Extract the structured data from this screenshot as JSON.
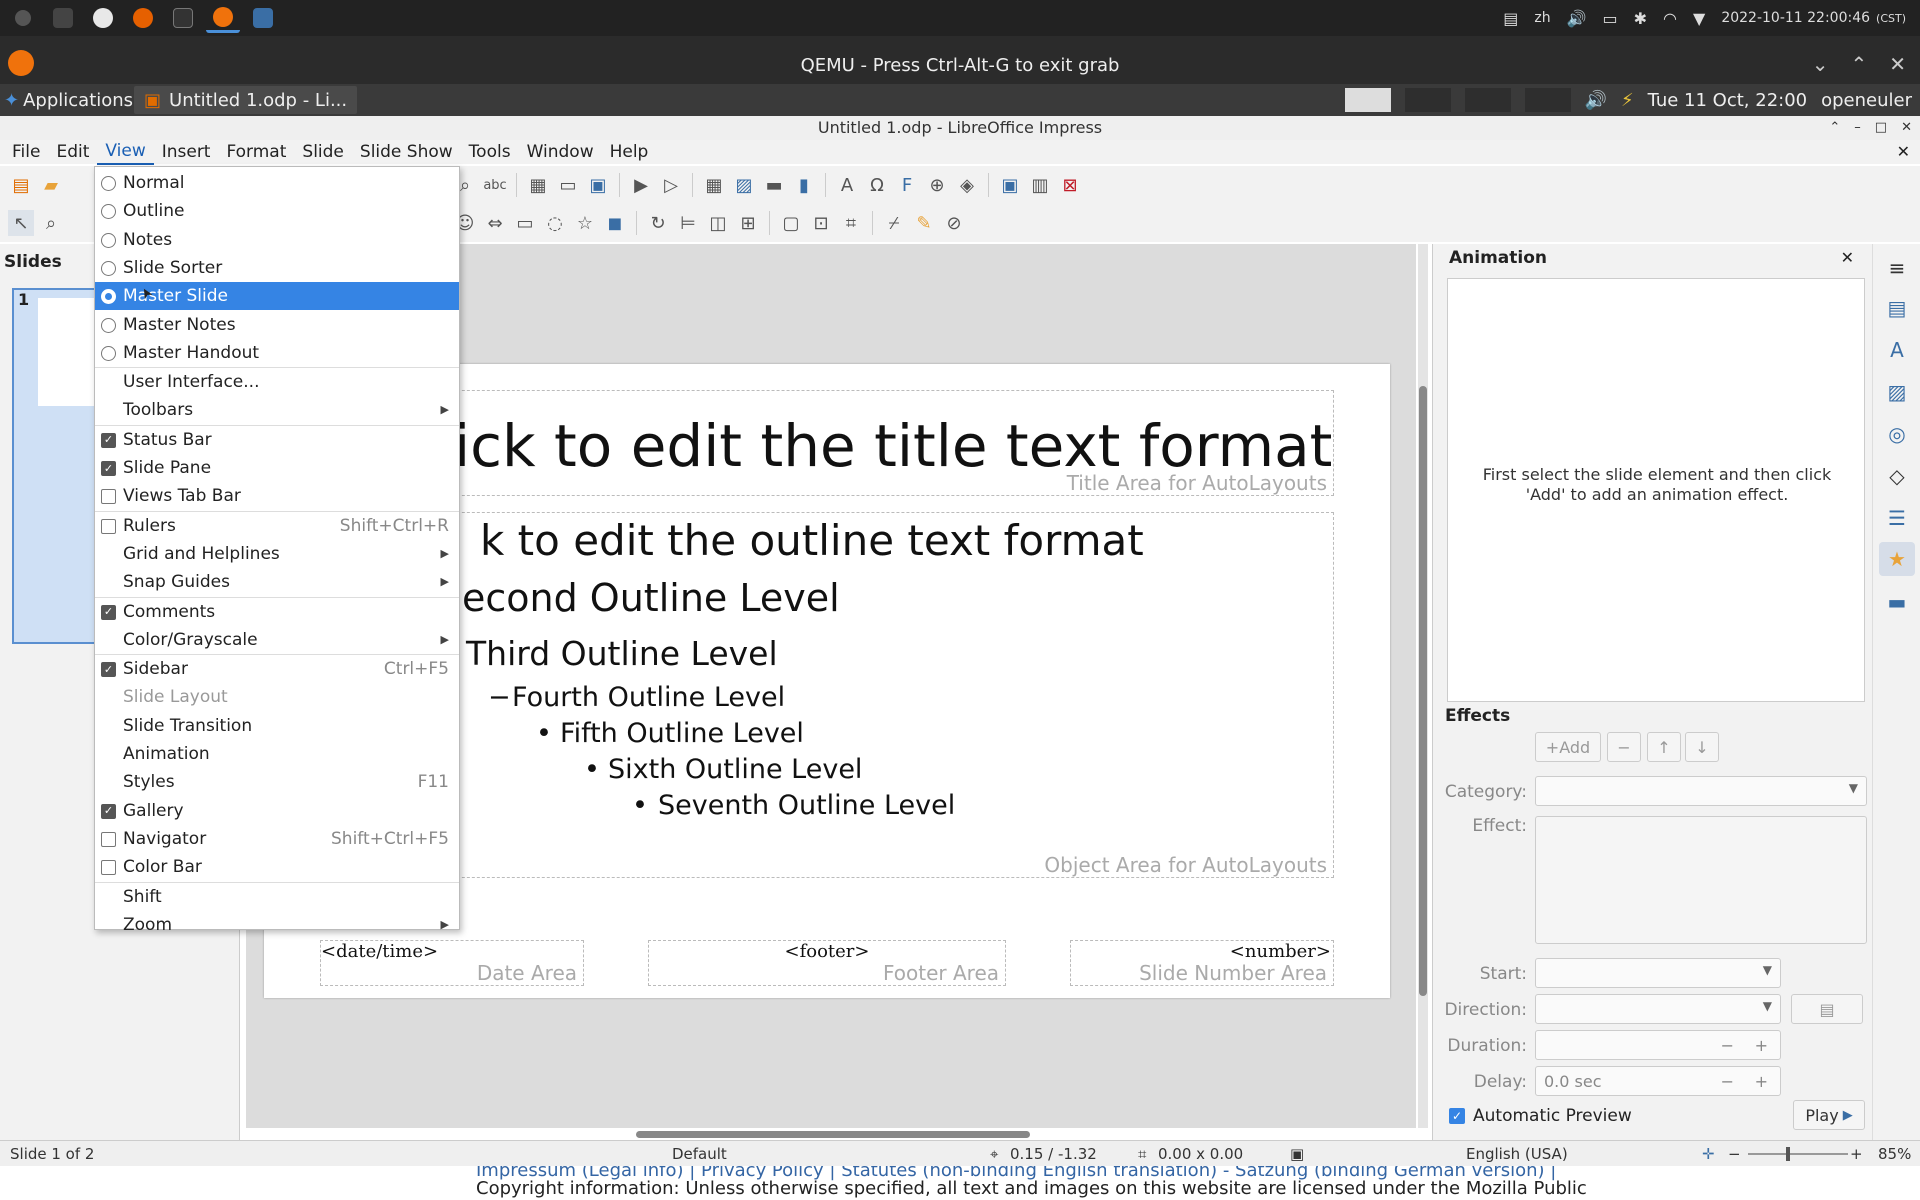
{
  "host": {
    "tray": {
      "lang": "zh",
      "datetime": "2022-10-11  22:00:46",
      "tz": "(CST)"
    }
  },
  "qemu": {
    "title": "QEMU - Press Ctrl-Alt-G to exit grab"
  },
  "guest": {
    "applications": "Applications",
    "task": "Untitled 1.odp - Li...",
    "clock": "Tue 11 Oct, 22:00",
    "user": "openeuler"
  },
  "window": {
    "title": "Untitled 1.odp - LibreOffice Impress"
  },
  "menubar": {
    "items": [
      "File",
      "Edit",
      "View",
      "Insert",
      "Format",
      "Slide",
      "Slide Show",
      "Tools",
      "Window",
      "Help"
    ]
  },
  "slides_pane": {
    "title": "Slides",
    "slide_number": "1"
  },
  "slide": {
    "title": "ick to edit the title text format",
    "title_area": "Title Area for AutoLayouts",
    "outline": [
      "k to edit the outline text format",
      "econd Outline Level",
      "Third Outline Level",
      "Fourth Outline Level",
      "Fifth Outline Level",
      "Sixth Outline Level",
      "Seventh Outline Level"
    ],
    "object_area": "Object Area for AutoLayouts",
    "date_field": "<date/time>",
    "date_area": "Date Area",
    "footer_field": "<footer>",
    "footer_area": "Footer Area",
    "number_field": "<number>",
    "number_area": "Slide Number Area"
  },
  "sidebar": {
    "title": "Animation",
    "message": "First select the slide element and then click 'Add' to add an animation effect.",
    "effects": "Effects",
    "add_button": "+Add",
    "category_label": "Category:",
    "effect_label": "Effect:",
    "start_label": "Start:",
    "direction_label": "Direction:",
    "duration_label": "Duration:",
    "delay_label": "Delay:",
    "delay_value": "0.0 sec",
    "auto_preview": "Automatic Preview",
    "play_button": "Play"
  },
  "statusbar": {
    "slide": "Slide 1 of 2",
    "layout": "Default",
    "position": "0.15 / -1.32",
    "size": "0.00 x 0.00",
    "language": "English (USA)",
    "zoom": "85%"
  },
  "background_web": {
    "line1": "Impressum (Legal info) | Privacy Policy | Statutes (non-binding English translation) - Satzung (binding German version) |",
    "line2": "Copyright information: Unless otherwise specified, all text and images on this website are licensed under the Mozilla Public"
  },
  "view_menu": {
    "items": [
      {
        "label": "Normal",
        "type": "radio",
        "on": false
      },
      {
        "label": "Outline",
        "type": "radio",
        "on": false
      },
      {
        "label": "Notes",
        "type": "radio",
        "on": false
      },
      {
        "label": "Slide Sorter",
        "type": "radio",
        "on": false
      },
      {
        "label": "Master Slide",
        "type": "radio",
        "on": true,
        "highlight": true
      },
      {
        "label": "Master Notes",
        "type": "radio",
        "on": false
      },
      {
        "label": "Master Handout",
        "type": "radio",
        "on": false
      },
      {
        "label": "User Interface...",
        "type": "plain"
      },
      {
        "label": "Toolbars",
        "type": "plain",
        "submenu": true
      },
      {
        "label": "Status Bar",
        "type": "check",
        "on": true
      },
      {
        "label": "Slide Pane",
        "type": "check",
        "on": true
      },
      {
        "label": "Views Tab Bar",
        "type": "check",
        "on": false
      },
      {
        "label": "Rulers",
        "type": "check",
        "on": false,
        "shortcut": "Shift+Ctrl+R"
      },
      {
        "label": "Grid and Helplines",
        "type": "plain",
        "submenu": true
      },
      {
        "label": "Snap Guides",
        "type": "plain",
        "submenu": true
      },
      {
        "label": "Comments",
        "type": "check",
        "on": true
      },
      {
        "label": "Color/Grayscale",
        "type": "plain",
        "submenu": true
      },
      {
        "label": "Sidebar",
        "type": "check",
        "on": true,
        "shortcut": "Ctrl+F5"
      },
      {
        "label": "Slide Layout",
        "type": "plain",
        "disabled": true
      },
      {
        "label": "Slide Transition",
        "type": "plain"
      },
      {
        "label": "Animation",
        "type": "plain"
      },
      {
        "label": "Styles",
        "type": "plain",
        "shortcut": "F11"
      },
      {
        "label": "Gallery",
        "type": "check",
        "on": true
      },
      {
        "label": "Navigator",
        "type": "check",
        "on": false,
        "shortcut": "Shift+Ctrl+F5"
      },
      {
        "label": "Color Bar",
        "type": "check",
        "on": false
      },
      {
        "label": "Shift",
        "type": "plain"
      },
      {
        "label": "Zoom",
        "type": "plain",
        "submenu": true
      }
    ]
  }
}
